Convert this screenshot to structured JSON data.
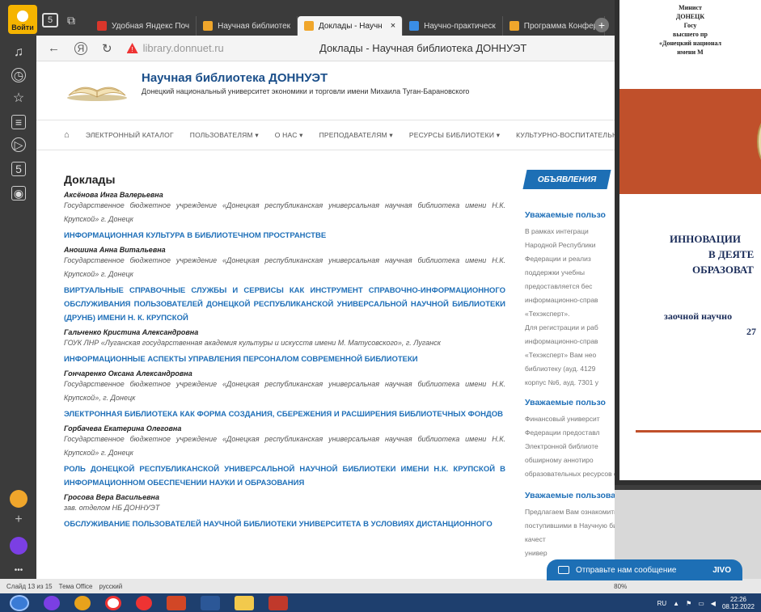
{
  "browser": {
    "login_label": "Войти",
    "tabs": [
      {
        "label": "Удобная Яндекс Поч",
        "color": "#d9362b"
      },
      {
        "label": "Научная библиотек",
        "color": "#f0a62b"
      },
      {
        "label": "Доклады - Научн",
        "color": "#f0a62b",
        "active": true,
        "close": "×"
      },
      {
        "label": "Научно-практическ",
        "color": "#3a8ee6"
      },
      {
        "label": "Программа Конфер",
        "color": "#f0a62b"
      }
    ],
    "new_tab": "+",
    "url": "library.donnuet.ru",
    "page_title": "Доклады - Научная библиотека ДОННУЭТ"
  },
  "site": {
    "title": "Научная библиотека ДОННУЭТ",
    "subtitle": "Донецкий национальный университет экономики и торговли имени Михаила Туган-Барановского",
    "menu": [
      "ЭЛЕКТРОННЫЙ КАТАЛОГ",
      "ПОЛЬЗОВАТЕЛЯМ ▾",
      "О НАС ▾",
      "ПРЕПОДАВАТЕЛЯМ ▾",
      "РЕСУРСЫ БИБЛИОТЕКИ ▾",
      "КУЛЬТУРНО-ВОСПИТАТЕЛЬНА"
    ]
  },
  "content": {
    "heading": "Доклады",
    "entries": [
      {
        "author": "Аксёнова Инга Валерьевна",
        "org": "Государственное бюджетное учреждение «Донецкая республиканская универсальная научная библиотека имени Н.К. Крупской» г. Донецк",
        "report": "ИНФОРМАЦИОННАЯ КУЛЬТУРА В БИБЛИОТЕЧНОМ ПРОСТРАНСТВЕ"
      },
      {
        "author": "Аношина Анна Витальевна",
        "org": "Государственное бюджетное учреждение «Донецкая республиканская универсальная научная библиотека имени Н.К. Крупской» г. Донецк",
        "report": "ВИРТУАЛЬНЫЕ СПРАВОЧНЫЕ СЛУЖБЫ И СЕРВИСЫ КАК ИНСТРУМЕНТ СПРАВОЧНО-ИНФОРМАЦИОННОГО ОБСЛУЖИВАНИЯ ПОЛЬЗОВАТЕЛЕЙ ДОНЕЦКОЙ РЕСПУБЛИКАНСКОЙ УНИВЕРСАЛЬНОЙ НАУЧНОЙ БИБЛИОТЕКИ (ДРУНБ) ИМЕНИ Н. К. КРУПСКОЙ"
      },
      {
        "author": "Гальченко Кристина Александровна",
        "org": "ГОУК ЛНР «Луганская государственная академия культуры и искусств имени М. Матусовского», г. Луганск",
        "report": "ИНФОРМАЦИОННЫЕ АСПЕКТЫ УПРАВЛЕНИЯ ПЕРСОНАЛОМ СОВРЕМЕННОЙ БИБЛИОТЕКИ"
      },
      {
        "author": "Гончаренко Оксана Александровна",
        "org": "Государственное бюджетное учреждение «Донецкая республиканская универсальная научная библиотека имени Н.К. Крупской», г. Донецк",
        "report": "ЭЛЕКТРОННАЯ БИБЛИОТЕКА КАК ФОРМА СОЗДАНИЯ, СБЕРЕЖЕНИЯ И РАСШИРЕНИЯ БИБЛИОТЕЧНЫХ ФОНДОВ"
      },
      {
        "author": "Горбачева Екатерина Олеговна",
        "org": "Государственное бюджетное учреждение «Донецкая республиканская универсальная научная библиотека имени Н.К. Крупской» г. Донецк",
        "report": "РОЛЬ ДОНЕЦКОЙ РЕСПУБЛИКАНСКОЙ УНИВЕРСАЛЬНОЙ НАУЧНОЙ БИБЛИОТЕКИ ИМЕНИ Н.К. КРУПСКОЙ В ИНФОРМАЦИОННОМ ОБЕСПЕЧЕНИИ НАУКИ И ОБРАЗОВАНИЯ"
      },
      {
        "author": "Гросова Вера Васильевна",
        "org": "зав. отделом НБ ДОННУЭТ",
        "report": "ОБСЛУЖИВАНИЕ ПОЛЬЗОВАТЕЛЕЙ НАУЧНОЙ БИБЛИОТЕКИ УНИВЕРСИТЕТА В УСЛОВИЯХ ДИСТАНЦИОННОГО"
      }
    ]
  },
  "sidebar": {
    "announcements": "ОБЪЯВЛЕНИЯ",
    "block1_title": "Уважаемые пользо",
    "block1_lines": [
      "В рамках интеграци",
      "Народной Республики",
      "Федерации и реализ",
      "поддержки учебны",
      "предоставляется бес",
      "информационно-справ",
      "«Техэксперт».",
      "Для регистрации и раб",
      "информационно-справ",
      "«Техэксперт» Вам нео",
      "библиотеку (ауд. 4129",
      "корпус №6, ауд. 7301 у"
    ],
    "block2_title": "Уважаемые пользо",
    "block2_lines": [
      "Финансовый университ",
      "Федерации предоставл",
      "Электронной библиоте",
      "обширному аннотиро",
      "образовательных ресурсов открытого доступа."
    ],
    "block3_title": "Уважаемые пользователи!",
    "block3_lines": [
      "Предлагаем Вам ознакомиться с изданиями,",
      "поступившими в Научную библиотеку ДОННУЭТ, в",
      "качест",
      "универ"
    ]
  },
  "slide": {
    "header_lines": [
      "Минист",
      "ДОНЕЦК",
      "Госу",
      "высшего пр",
      "«Донецкий национал",
      "имени М"
    ],
    "title_lines": [
      "ИННОВАЦИИ",
      "В ДЕЯТЕ",
      "ОБРАЗОВАТ"
    ],
    "sub_lines": [
      "заочной научно",
      "27"
    ]
  },
  "chat": {
    "label": "Отправьте нам сообщение",
    "brand": "JIVO"
  },
  "ppt_status": {
    "slide": "Слайд 13 из 15",
    "theme": "Тема Office",
    "lang": "русский",
    "zoom": "80%"
  },
  "taskbar": {
    "lang": "RU",
    "time": "22:26",
    "date": "08.12.2022"
  }
}
